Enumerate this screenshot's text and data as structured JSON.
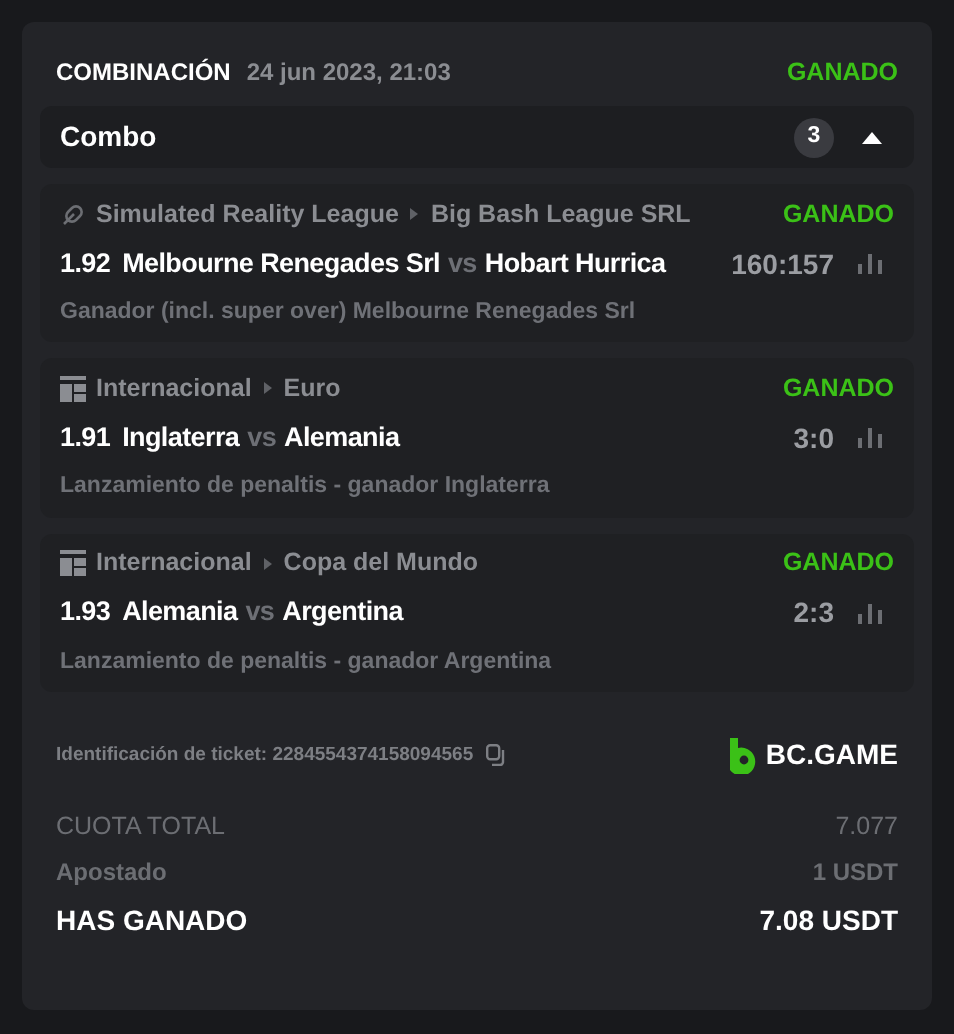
{
  "bet": {
    "type": "COMBINACIÓN",
    "date": "24 jun 2023, 21:03",
    "status": "GANADO"
  },
  "combo": {
    "label": "Combo",
    "count": "3",
    "expanded": true
  },
  "legs": [
    {
      "kind": "virtual",
      "league": "Simulated Reality League",
      "event": "Big Bash League SRL",
      "status": "GANADO",
      "odds": "1.92",
      "home": "Melbourne Renegades Srl",
      "vs": "vs",
      "away": "Hobart Hurrica",
      "score": "160:157",
      "market": "Ganador (incl. super over) Melbourne Renegades Srl"
    },
    {
      "kind": "esport",
      "league": "Internacional",
      "event": "Euro",
      "status": "GANADO",
      "odds": "1.91",
      "home": "Inglaterra",
      "vs": "vs",
      "away": "Alemania",
      "score": "3:0",
      "market": "Lanzamiento de penaltis - ganador Inglaterra"
    },
    {
      "kind": "esport",
      "league": "Internacional",
      "event": "Copa del Mundo",
      "status": "GANADO",
      "odds": "1.93",
      "home": "Alemania",
      "vs": "vs",
      "away": "Argentina",
      "score": "2:3",
      "market": "Lanzamiento de penaltis - ganador Argentina"
    }
  ],
  "ticket": {
    "label": "Identificación de ticket: 2284554374158094565",
    "brand": "BC.GAME"
  },
  "summary": [
    {
      "kind": "odds",
      "label": "CUOTA TOTAL",
      "value": "7.077"
    },
    {
      "kind": "stake",
      "label": "Apostado",
      "value": "1 USDT"
    },
    {
      "kind": "win",
      "label": "HAS GANADO",
      "value": "7.08 USDT"
    }
  ]
}
